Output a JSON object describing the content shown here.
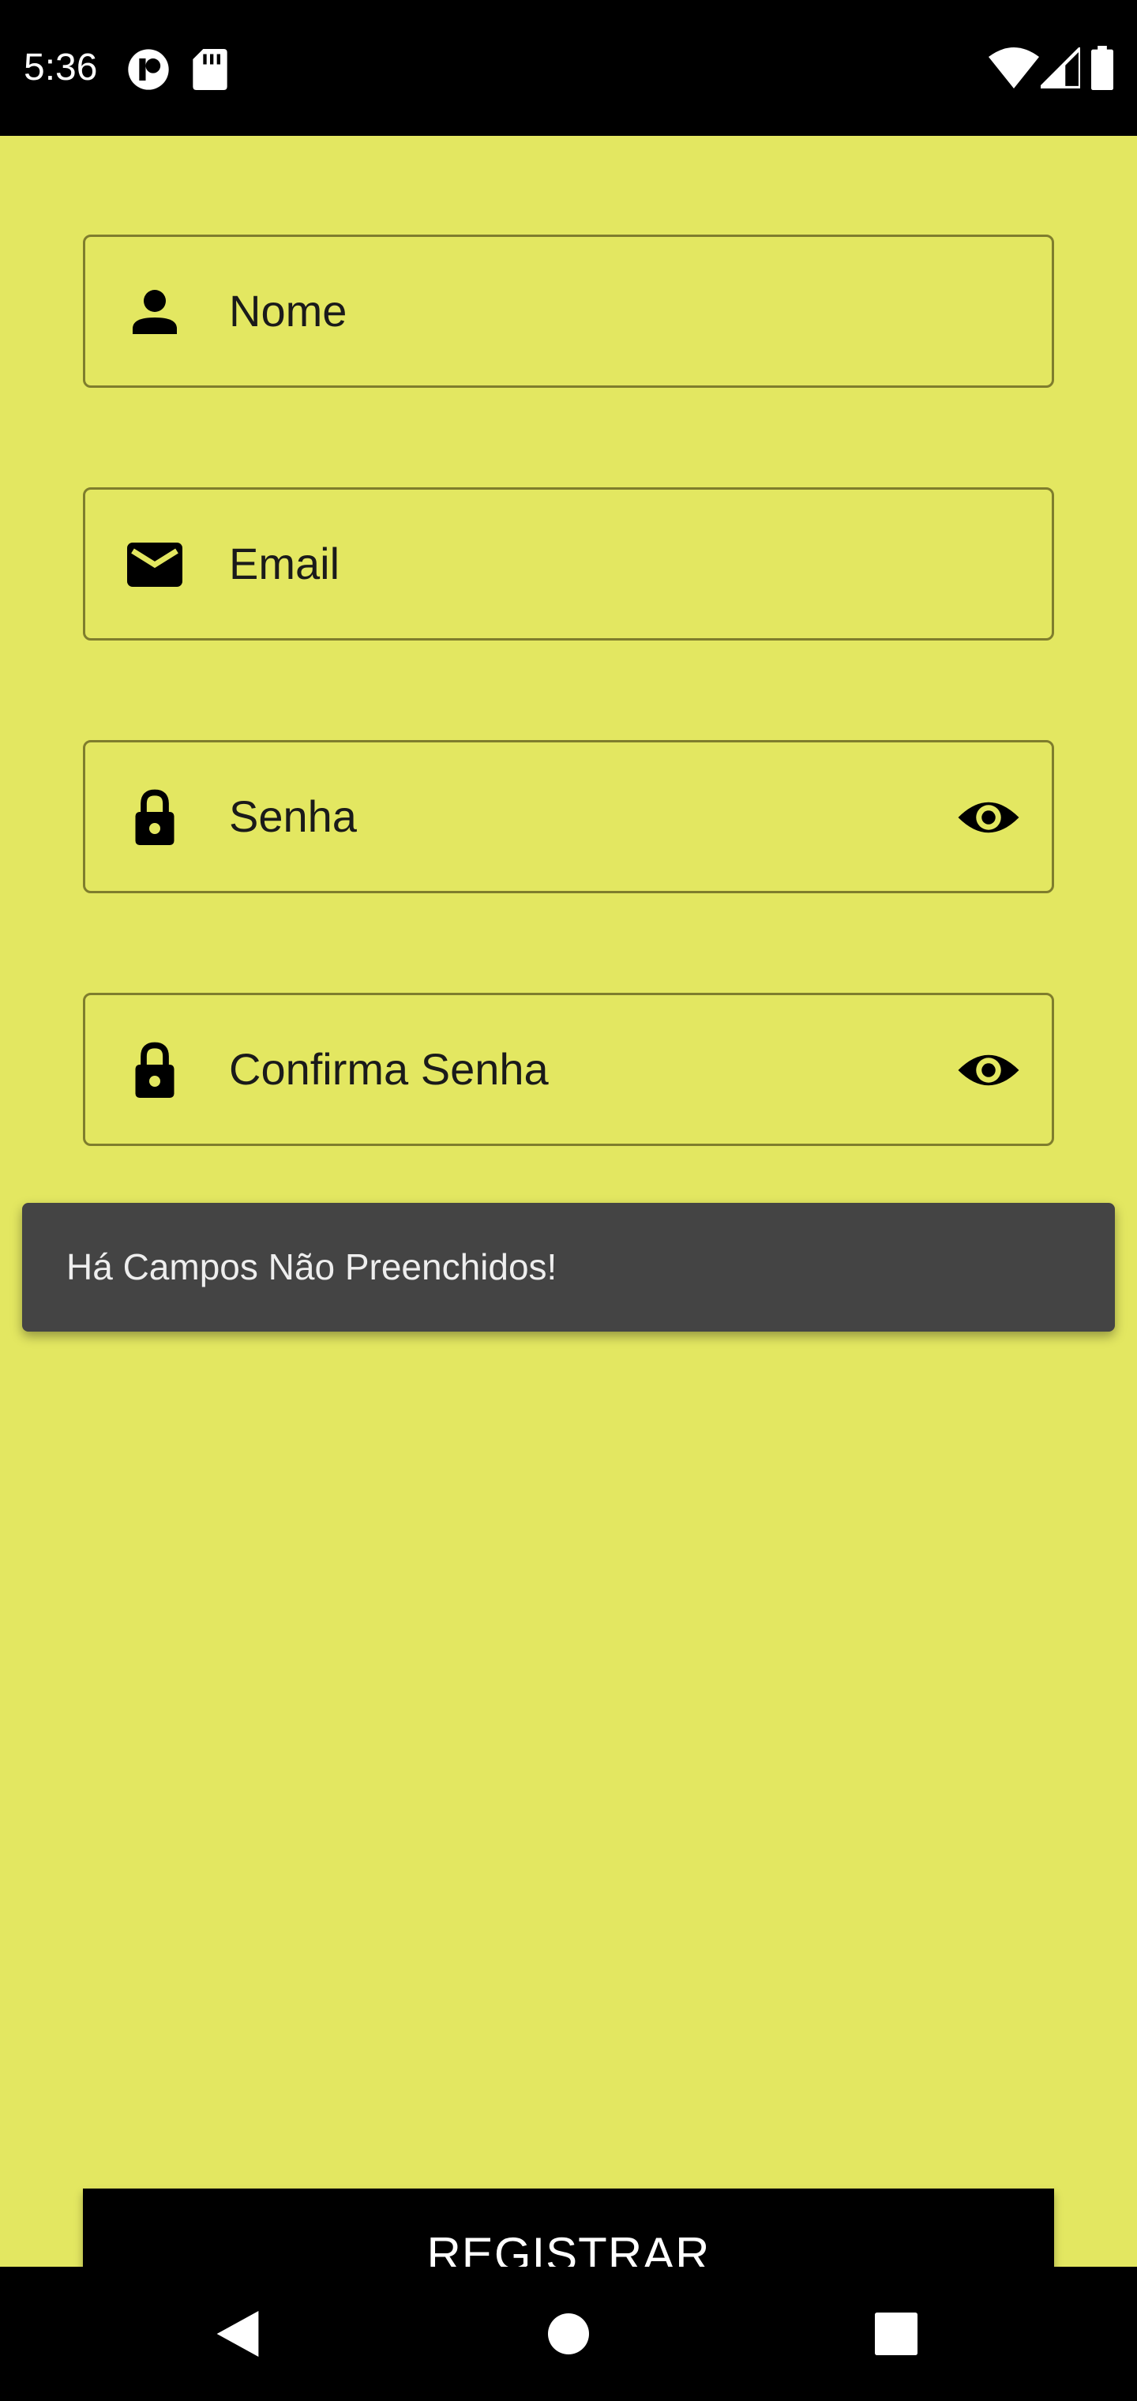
{
  "status_bar": {
    "time": "5:36",
    "icons_left": [
      "app-notification-icon",
      "sd-card-icon"
    ],
    "icons_right": [
      "wifi-icon",
      "cell-signal-icon",
      "battery-icon"
    ]
  },
  "form": {
    "fields": [
      {
        "label": "Nome",
        "icon": "person-icon",
        "value": ""
      },
      {
        "label": "Email",
        "icon": "mail-icon",
        "value": ""
      },
      {
        "label": "Senha",
        "icon": "lock-icon",
        "value": "",
        "trailing_icon": "eye-icon"
      },
      {
        "label": "Confirma Senha",
        "icon": "lock-icon",
        "value": "",
        "trailing_icon": "eye-icon"
      }
    ],
    "submit_label": "REGISTRAR"
  },
  "toast": {
    "message": "Há Campos Não Preenchidos!"
  },
  "nav_bar": {
    "buttons": [
      "back-icon",
      "home-icon",
      "recents-icon"
    ]
  },
  "colors": {
    "background": "#e3e761",
    "field_border": "#7f7d2d",
    "toast_background": "#444444",
    "button_background": "#000000",
    "button_text": "#ffffff",
    "system_bars": "#000000"
  }
}
